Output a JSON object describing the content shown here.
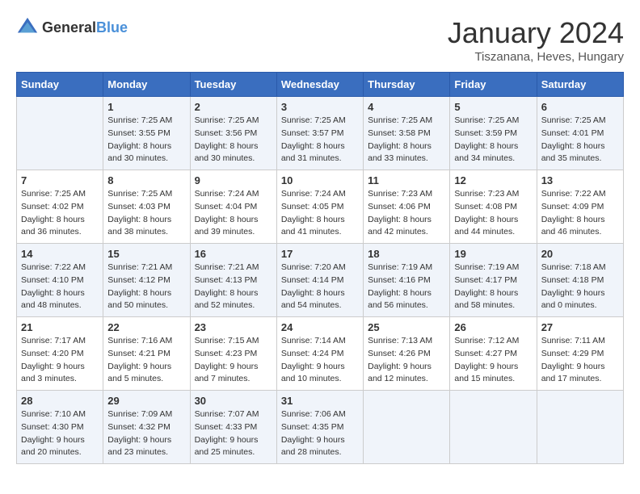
{
  "header": {
    "logo_general": "General",
    "logo_blue": "Blue",
    "month_title": "January 2024",
    "location": "Tiszanana, Heves, Hungary"
  },
  "weekdays": [
    "Sunday",
    "Monday",
    "Tuesday",
    "Wednesday",
    "Thursday",
    "Friday",
    "Saturday"
  ],
  "weeks": [
    [
      {
        "day": "",
        "sunrise": "",
        "sunset": "",
        "daylight": ""
      },
      {
        "day": "1",
        "sunrise": "Sunrise: 7:25 AM",
        "sunset": "Sunset: 3:55 PM",
        "daylight": "Daylight: 8 hours and 30 minutes."
      },
      {
        "day": "2",
        "sunrise": "Sunrise: 7:25 AM",
        "sunset": "Sunset: 3:56 PM",
        "daylight": "Daylight: 8 hours and 30 minutes."
      },
      {
        "day": "3",
        "sunrise": "Sunrise: 7:25 AM",
        "sunset": "Sunset: 3:57 PM",
        "daylight": "Daylight: 8 hours and 31 minutes."
      },
      {
        "day": "4",
        "sunrise": "Sunrise: 7:25 AM",
        "sunset": "Sunset: 3:58 PM",
        "daylight": "Daylight: 8 hours and 33 minutes."
      },
      {
        "day": "5",
        "sunrise": "Sunrise: 7:25 AM",
        "sunset": "Sunset: 3:59 PM",
        "daylight": "Daylight: 8 hours and 34 minutes."
      },
      {
        "day": "6",
        "sunrise": "Sunrise: 7:25 AM",
        "sunset": "Sunset: 4:01 PM",
        "daylight": "Daylight: 8 hours and 35 minutes."
      }
    ],
    [
      {
        "day": "7",
        "sunrise": "Sunrise: 7:25 AM",
        "sunset": "Sunset: 4:02 PM",
        "daylight": "Daylight: 8 hours and 36 minutes."
      },
      {
        "day": "8",
        "sunrise": "Sunrise: 7:25 AM",
        "sunset": "Sunset: 4:03 PM",
        "daylight": "Daylight: 8 hours and 38 minutes."
      },
      {
        "day": "9",
        "sunrise": "Sunrise: 7:24 AM",
        "sunset": "Sunset: 4:04 PM",
        "daylight": "Daylight: 8 hours and 39 minutes."
      },
      {
        "day": "10",
        "sunrise": "Sunrise: 7:24 AM",
        "sunset": "Sunset: 4:05 PM",
        "daylight": "Daylight: 8 hours and 41 minutes."
      },
      {
        "day": "11",
        "sunrise": "Sunrise: 7:23 AM",
        "sunset": "Sunset: 4:06 PM",
        "daylight": "Daylight: 8 hours and 42 minutes."
      },
      {
        "day": "12",
        "sunrise": "Sunrise: 7:23 AM",
        "sunset": "Sunset: 4:08 PM",
        "daylight": "Daylight: 8 hours and 44 minutes."
      },
      {
        "day": "13",
        "sunrise": "Sunrise: 7:22 AM",
        "sunset": "Sunset: 4:09 PM",
        "daylight": "Daylight: 8 hours and 46 minutes."
      }
    ],
    [
      {
        "day": "14",
        "sunrise": "Sunrise: 7:22 AM",
        "sunset": "Sunset: 4:10 PM",
        "daylight": "Daylight: 8 hours and 48 minutes."
      },
      {
        "day": "15",
        "sunrise": "Sunrise: 7:21 AM",
        "sunset": "Sunset: 4:12 PM",
        "daylight": "Daylight: 8 hours and 50 minutes."
      },
      {
        "day": "16",
        "sunrise": "Sunrise: 7:21 AM",
        "sunset": "Sunset: 4:13 PM",
        "daylight": "Daylight: 8 hours and 52 minutes."
      },
      {
        "day": "17",
        "sunrise": "Sunrise: 7:20 AM",
        "sunset": "Sunset: 4:14 PM",
        "daylight": "Daylight: 8 hours and 54 minutes."
      },
      {
        "day": "18",
        "sunrise": "Sunrise: 7:19 AM",
        "sunset": "Sunset: 4:16 PM",
        "daylight": "Daylight: 8 hours and 56 minutes."
      },
      {
        "day": "19",
        "sunrise": "Sunrise: 7:19 AM",
        "sunset": "Sunset: 4:17 PM",
        "daylight": "Daylight: 8 hours and 58 minutes."
      },
      {
        "day": "20",
        "sunrise": "Sunrise: 7:18 AM",
        "sunset": "Sunset: 4:18 PM",
        "daylight": "Daylight: 9 hours and 0 minutes."
      }
    ],
    [
      {
        "day": "21",
        "sunrise": "Sunrise: 7:17 AM",
        "sunset": "Sunset: 4:20 PM",
        "daylight": "Daylight: 9 hours and 3 minutes."
      },
      {
        "day": "22",
        "sunrise": "Sunrise: 7:16 AM",
        "sunset": "Sunset: 4:21 PM",
        "daylight": "Daylight: 9 hours and 5 minutes."
      },
      {
        "day": "23",
        "sunrise": "Sunrise: 7:15 AM",
        "sunset": "Sunset: 4:23 PM",
        "daylight": "Daylight: 9 hours and 7 minutes."
      },
      {
        "day": "24",
        "sunrise": "Sunrise: 7:14 AM",
        "sunset": "Sunset: 4:24 PM",
        "daylight": "Daylight: 9 hours and 10 minutes."
      },
      {
        "day": "25",
        "sunrise": "Sunrise: 7:13 AM",
        "sunset": "Sunset: 4:26 PM",
        "daylight": "Daylight: 9 hours and 12 minutes."
      },
      {
        "day": "26",
        "sunrise": "Sunrise: 7:12 AM",
        "sunset": "Sunset: 4:27 PM",
        "daylight": "Daylight: 9 hours and 15 minutes."
      },
      {
        "day": "27",
        "sunrise": "Sunrise: 7:11 AM",
        "sunset": "Sunset: 4:29 PM",
        "daylight": "Daylight: 9 hours and 17 minutes."
      }
    ],
    [
      {
        "day": "28",
        "sunrise": "Sunrise: 7:10 AM",
        "sunset": "Sunset: 4:30 PM",
        "daylight": "Daylight: 9 hours and 20 minutes."
      },
      {
        "day": "29",
        "sunrise": "Sunrise: 7:09 AM",
        "sunset": "Sunset: 4:32 PM",
        "daylight": "Daylight: 9 hours and 23 minutes."
      },
      {
        "day": "30",
        "sunrise": "Sunrise: 7:07 AM",
        "sunset": "Sunset: 4:33 PM",
        "daylight": "Daylight: 9 hours and 25 minutes."
      },
      {
        "day": "31",
        "sunrise": "Sunrise: 7:06 AM",
        "sunset": "Sunset: 4:35 PM",
        "daylight": "Daylight: 9 hours and 28 minutes."
      },
      {
        "day": "",
        "sunrise": "",
        "sunset": "",
        "daylight": ""
      },
      {
        "day": "",
        "sunrise": "",
        "sunset": "",
        "daylight": ""
      },
      {
        "day": "",
        "sunrise": "",
        "sunset": "",
        "daylight": ""
      }
    ]
  ]
}
